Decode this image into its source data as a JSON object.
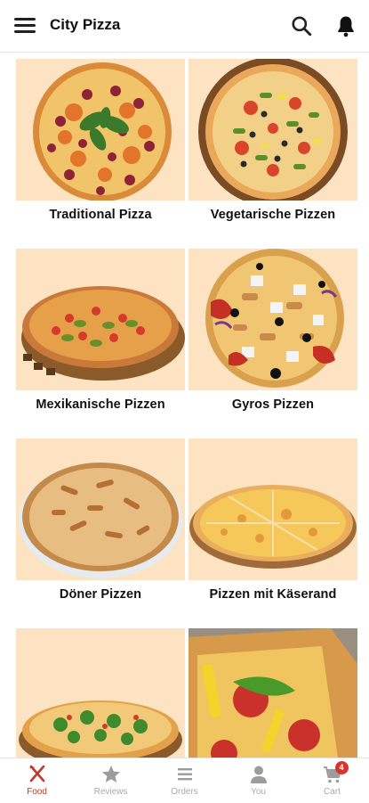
{
  "app": {
    "title": "City Pizza"
  },
  "colors": {
    "tile_background": "#fde3c2",
    "accent": "#c0392b",
    "badge": "#d9342b",
    "inactive": "#aaaaaa"
  },
  "icons": {
    "menu": "hamburger-menu-icon",
    "search": "search-icon",
    "notifications": "bell-icon"
  },
  "categories": [
    {
      "name": "Traditional Pizza"
    },
    {
      "name": "Vegetarische Pizzen"
    },
    {
      "name": "Mexikanische Pizzen"
    },
    {
      "name": "Gyros Pizzen"
    },
    {
      "name": "Döner Pizzen"
    },
    {
      "name": "Pizzen mit Käserand"
    },
    {
      "name": ""
    },
    {
      "name": ""
    }
  ],
  "bottom_nav": {
    "items": [
      {
        "label": "Food",
        "icon": "fork-knife-icon",
        "active": true
      },
      {
        "label": "Reviews",
        "icon": "star-icon"
      },
      {
        "label": "Orders",
        "icon": "list-icon"
      },
      {
        "label": "You",
        "icon": "user-icon"
      },
      {
        "label": "Cart",
        "icon": "cart-icon"
      }
    ],
    "cart_badge": "4"
  }
}
